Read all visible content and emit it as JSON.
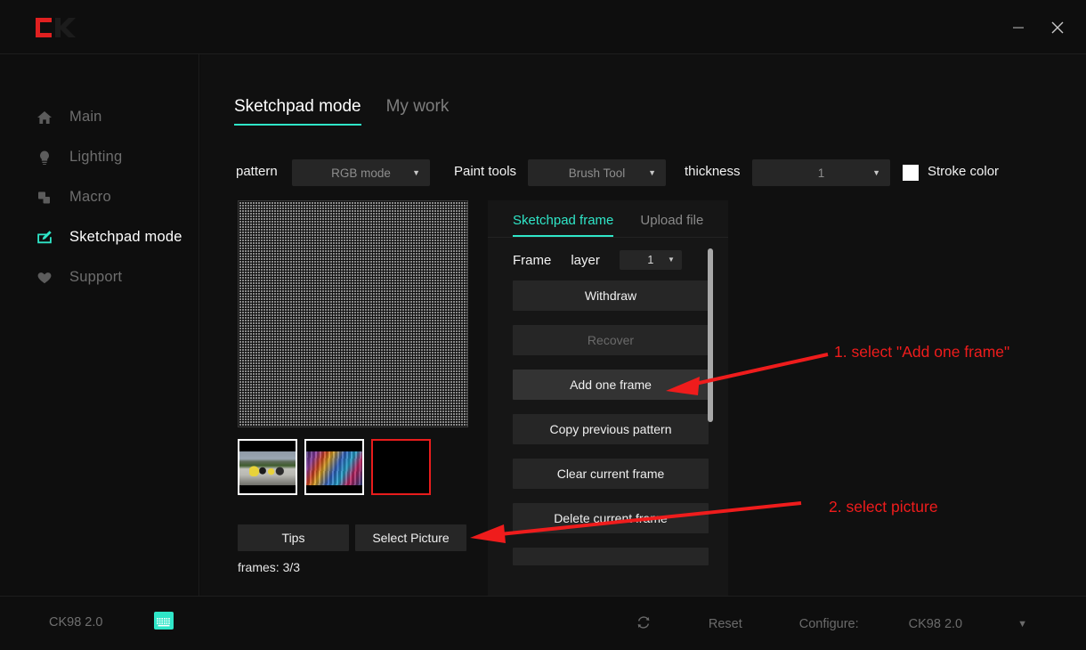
{
  "window": {
    "logo_name": "ck-logo",
    "minimize_label": "minimize-icon",
    "close_label": "close-icon"
  },
  "sidebar": {
    "items": [
      {
        "label": "Main",
        "icon": "home-icon",
        "active": false
      },
      {
        "label": "Lighting",
        "icon": "lightbulb-icon",
        "active": false
      },
      {
        "label": "Macro",
        "icon": "macro-squares-icon",
        "active": false
      },
      {
        "label": "Sketchpad mode",
        "icon": "sketchpad-icon",
        "active": true
      },
      {
        "label": "Support",
        "icon": "heart-icon",
        "active": false
      }
    ]
  },
  "main": {
    "tabs": [
      {
        "label": "Sketchpad mode",
        "active": true
      },
      {
        "label": "My work",
        "active": false
      }
    ],
    "toolbar": {
      "pattern_label": "pattern",
      "pattern_value": "RGB mode",
      "paint_tools_label": "Paint tools",
      "paint_tools_value": "Brush Tool",
      "thickness_label": "thickness",
      "thickness_value": "1",
      "stroke_color_label": "Stroke color",
      "stroke_color_value": "#ffffff",
      "caret": "▼"
    },
    "canvas": {
      "name": "sketchpad-canvas"
    },
    "thumbnails": [
      {
        "name": "frame-thumbnail-1",
        "selected": false
      },
      {
        "name": "frame-thumbnail-2",
        "selected": false
      },
      {
        "name": "frame-thumbnail-3",
        "selected": true
      }
    ],
    "tips_label": "Tips",
    "select_picture_label": "Select Picture",
    "frames_status": "frames: 3/3"
  },
  "frame_panel": {
    "tabs": [
      {
        "label": "Sketchpad frame",
        "active": true
      },
      {
        "label": "Upload file",
        "active": false
      }
    ],
    "frame_label": "Frame",
    "layer_label": "layer",
    "layer_value": "1",
    "caret": "▼",
    "buttons": [
      {
        "label": "Withdraw",
        "state": "normal"
      },
      {
        "label": "Recover",
        "state": "disabled"
      },
      {
        "label": "Add one frame",
        "state": "highlighted"
      },
      {
        "label": "Copy previous pattern",
        "state": "normal"
      },
      {
        "label": "Clear current frame",
        "state": "normal"
      },
      {
        "label": "Delete current frame",
        "state": "normal"
      }
    ]
  },
  "annotations": [
    {
      "text": "1. select \"Add one frame\"",
      "color": "#ef1c1c"
    },
    {
      "text": "2. select picture",
      "color": "#ef1c1c"
    }
  ],
  "footer": {
    "device_name": "CK98 2.0",
    "keyboard_icon": "keyboard-icon",
    "refresh_icon": "refresh-icon",
    "reset_label": "Reset",
    "configure_label": "Configure:",
    "configure_value": "CK98 2.0",
    "configure_caret": "▼"
  }
}
